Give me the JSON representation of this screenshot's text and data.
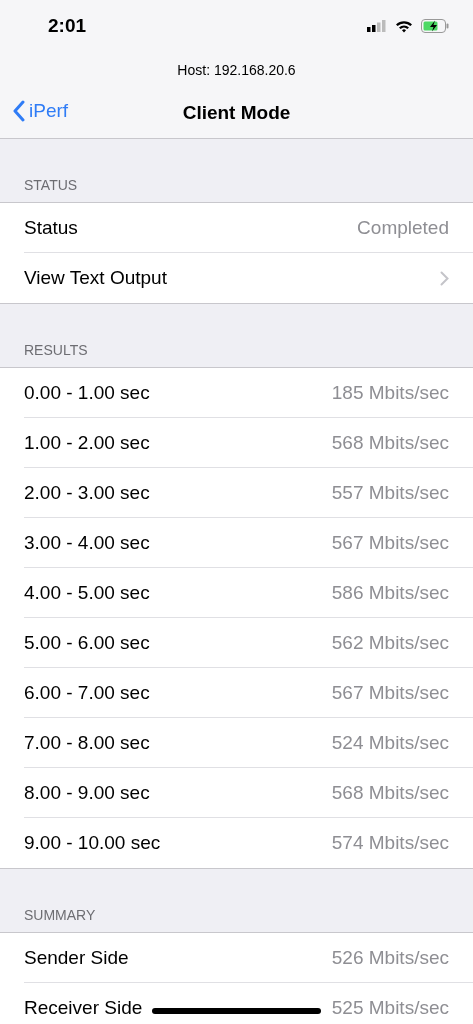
{
  "status_bar": {
    "time": "2:01"
  },
  "host": "Host: 192.168.20.6",
  "nav": {
    "back": "iPerf",
    "title": "Client Mode"
  },
  "sections": [
    {
      "header": "STATUS",
      "rows": [
        {
          "kind": "value",
          "label": "Status",
          "value": "Completed"
        },
        {
          "kind": "disclosure",
          "label": "View Text Output"
        }
      ]
    },
    {
      "header": "RESULTS",
      "rows": [
        {
          "kind": "value",
          "label": "0.00 - 1.00 sec",
          "value": "185 Mbits/sec"
        },
        {
          "kind": "value",
          "label": "1.00 - 2.00 sec",
          "value": "568 Mbits/sec"
        },
        {
          "kind": "value",
          "label": "2.00 - 3.00 sec",
          "value": "557 Mbits/sec"
        },
        {
          "kind": "value",
          "label": "3.00 - 4.00 sec",
          "value": "567 Mbits/sec"
        },
        {
          "kind": "value",
          "label": "4.00 - 5.00 sec",
          "value": "586 Mbits/sec"
        },
        {
          "kind": "value",
          "label": "5.00 - 6.00 sec",
          "value": "562 Mbits/sec"
        },
        {
          "kind": "value",
          "label": "6.00 - 7.00 sec",
          "value": "567 Mbits/sec"
        },
        {
          "kind": "value",
          "label": "7.00 - 8.00 sec",
          "value": "524 Mbits/sec"
        },
        {
          "kind": "value",
          "label": "8.00 - 9.00 sec",
          "value": "568 Mbits/sec"
        },
        {
          "kind": "value",
          "label": "9.00 - 10.00 sec",
          "value": "574 Mbits/sec"
        }
      ]
    },
    {
      "header": "SUMMARY",
      "rows": [
        {
          "kind": "value",
          "label": "Sender Side",
          "value": "526 Mbits/sec"
        },
        {
          "kind": "value",
          "label": "Receiver Side",
          "value": "525 Mbits/sec"
        }
      ]
    }
  ]
}
